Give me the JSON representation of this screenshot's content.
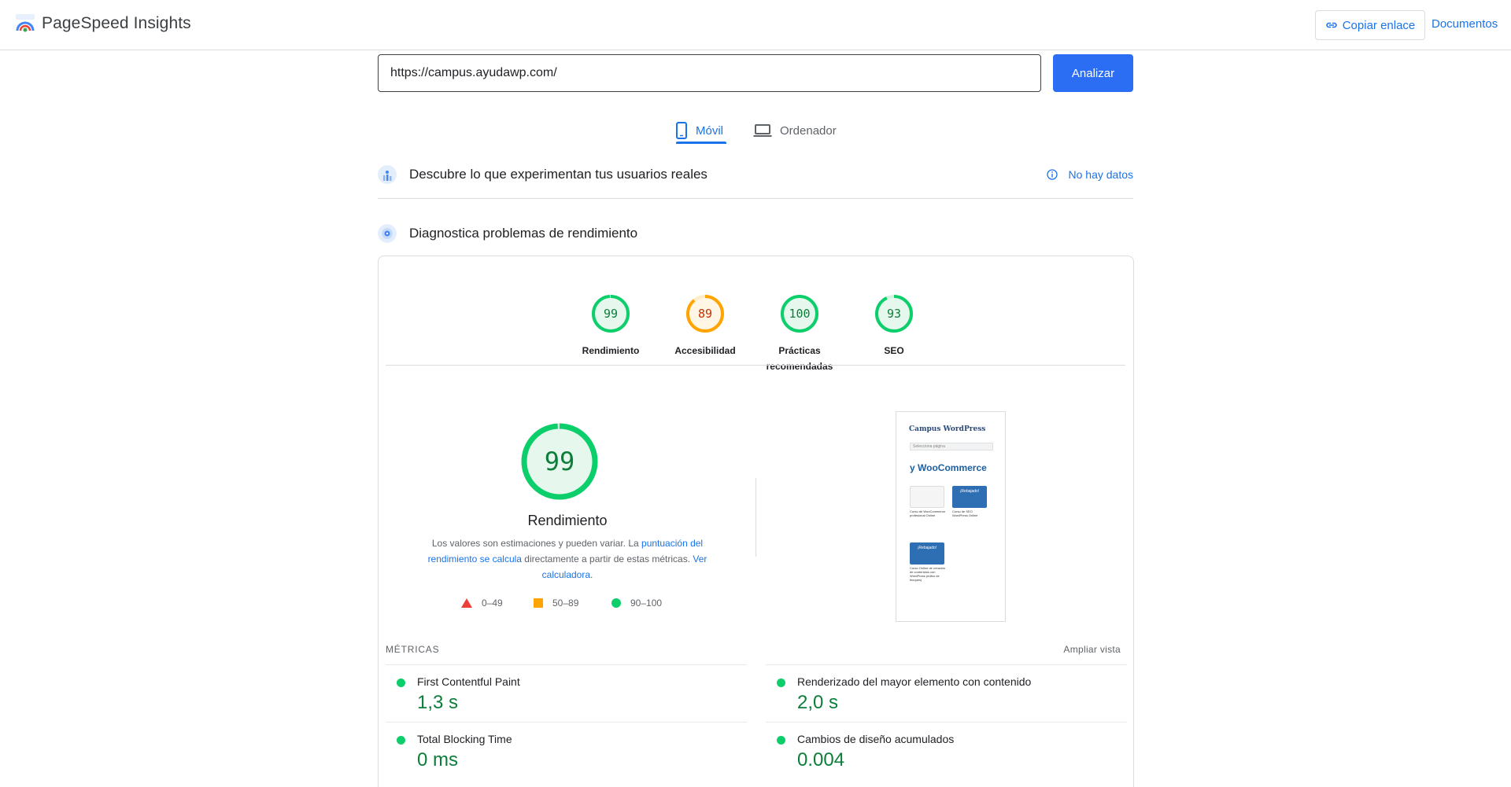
{
  "header": {
    "app_name": "PageSpeed Insights",
    "copy_link_label": "Copiar enlace",
    "docs_label": "Documentos"
  },
  "search": {
    "url_value": "https://campus.ayudawp.com/",
    "analyze_label": "Analizar"
  },
  "tabs": [
    {
      "label": "Móvil",
      "icon": "smartphone-icon",
      "active": true
    },
    {
      "label": "Ordenador",
      "icon": "laptop-icon",
      "active": false
    }
  ],
  "real_users": {
    "title": "Descubre lo que experimentan tus usuarios reales",
    "status_label": "No hay datos"
  },
  "diagnostics": {
    "title": "Diagnostica problemas de rendimiento"
  },
  "scores": [
    {
      "value": 99,
      "label": "Rendimiento",
      "color": "#0cce6b",
      "text_color": "#0d7d3a"
    },
    {
      "value": 89,
      "label": "Accesibilidad",
      "color": "#ffa400",
      "text_color": "#c33300"
    },
    {
      "value": 100,
      "label": "Prácticas recomendadas",
      "color": "#0cce6b",
      "text_color": "#0d7d3a"
    },
    {
      "value": 93,
      "label": "SEO",
      "color": "#0cce6b",
      "text_color": "#0d7d3a"
    }
  ],
  "performance": {
    "score": 99,
    "title": "Rendimiento",
    "desc_prefix": "Los valores son estimaciones y pueden variar. La ",
    "desc_link1": "puntuación del rendimiento se calcula",
    "desc_middle": " directamente a partir de estas métricas. ",
    "desc_link2": "Ver calculadora",
    "desc_suffix": ".",
    "legend": {
      "fail": "0–49",
      "average": "50–89",
      "pass": "90–100"
    }
  },
  "screenshot_preview": {
    "logo_text": "Campus WordPress",
    "search_placeholder": "Selecciona página",
    "heading": "y WooCommerce",
    "badge": "¡Rebajado!",
    "captions": [
      "Curso de WooCommerce profesional Online",
      "Curso de SEO WordPress Online",
      "Curso Online de creación de contenidos con WordPress (editor de bloques)"
    ]
  },
  "metrics": {
    "heading": "MÉTRICAS",
    "expand_label": "Ampliar vista",
    "items": [
      {
        "label": "First Contentful Paint",
        "value": "1,3 s"
      },
      {
        "label": "Renderizado del mayor elemento con contenido",
        "value": "2,0 s"
      },
      {
        "label": "Total Blocking Time",
        "value": "0 ms"
      },
      {
        "label": "Cambios de diseño acumulados",
        "value": "0.004"
      }
    ]
  },
  "colors": {
    "accent": "#1a73e8",
    "pass": "#0cce6b",
    "average": "#ffa400",
    "fail": "#eb3f3a"
  }
}
